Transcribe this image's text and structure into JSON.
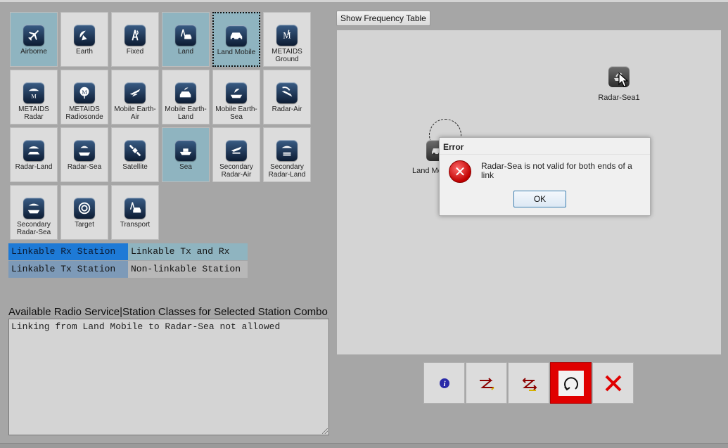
{
  "stations": [
    {
      "label": "Airborne",
      "icon": "airplane-icon",
      "state": "highlight"
    },
    {
      "label": "Earth",
      "icon": "dish-icon",
      "state": "normal"
    },
    {
      "label": "Fixed",
      "icon": "tower-icon",
      "state": "normal"
    },
    {
      "label": "Land",
      "icon": "tower-car-icon",
      "state": "highlight"
    },
    {
      "label": "Land Mobile",
      "icon": "car-icon",
      "state": "selected"
    },
    {
      "label": "METAIDS Ground",
      "icon": "metaids-ground-icon",
      "state": "normal"
    },
    {
      "label": "METAIDS Radar",
      "icon": "radar-icon",
      "state": "normal"
    },
    {
      "label": "METAIDS Radiosonde",
      "icon": "balloon-icon",
      "state": "normal"
    },
    {
      "label": "Mobile Earth-Air",
      "icon": "plane-dish-icon",
      "state": "normal"
    },
    {
      "label": "Mobile Earth-Land",
      "icon": "car-dish-icon",
      "state": "normal"
    },
    {
      "label": "Mobile Earth-Sea",
      "icon": "ship-dish-icon",
      "state": "normal"
    },
    {
      "label": "Radar-Air",
      "icon": "radar-plane-icon",
      "state": "normal"
    },
    {
      "label": "Radar-Land",
      "icon": "radar-land-icon",
      "state": "normal"
    },
    {
      "label": "Radar-Sea",
      "icon": "radar-sea-icon",
      "state": "normal"
    },
    {
      "label": "Satellite",
      "icon": "satellite-icon",
      "state": "normal"
    },
    {
      "label": "Sea",
      "icon": "ship-icon",
      "state": "highlight"
    },
    {
      "label": "Secondary Radar-Air",
      "icon": "secondary-radar-air-icon",
      "state": "normal"
    },
    {
      "label": "Secondary Radar-Land",
      "icon": "secondary-radar-land-icon",
      "state": "normal"
    },
    {
      "label": "Secondary Radar-Sea",
      "icon": "secondary-radar-sea-icon",
      "state": "normal"
    },
    {
      "label": "Target",
      "icon": "target-icon",
      "state": "normal"
    },
    {
      "label": "Transport",
      "icon": "transport-icon",
      "state": "normal"
    }
  ],
  "legend": {
    "rx": {
      "label": "Linkable Rx Station",
      "color": "#1e7ad6"
    },
    "txrx": {
      "label": "Linkable Tx and Rx",
      "color": "#8fb4c0"
    },
    "tx": {
      "label": "Linkable Tx Station",
      "color": "#7d9ab8"
    },
    "none": {
      "label": "Non-linkable Station",
      "color": "#b8b8b8"
    }
  },
  "available": {
    "title": "Available Radio Service|Station Classes for Selected Station Combo",
    "text": "Linking from Land Mobile to Radar-Sea not allowed"
  },
  "frequency_button": "Show Frequency Table",
  "canvas": {
    "nodes": [
      {
        "label": "Radar-Sea1",
        "icon": "radar-sea-icon"
      },
      {
        "label": "Land Mobile",
        "icon": "car-icon"
      }
    ]
  },
  "dialog": {
    "title": "Error",
    "message": "Radar-Sea is not valid for both ends of a link",
    "ok": "OK"
  },
  "toolbar": [
    {
      "name": "info-button",
      "icon": "info-icon"
    },
    {
      "name": "link-tx-button",
      "icon": "link-arrows-icon"
    },
    {
      "name": "swap-direction-button",
      "icon": "swap-arrows-icon"
    },
    {
      "name": "reset-button",
      "icon": "rotate-icon",
      "active": true
    },
    {
      "name": "delete-button",
      "icon": "close-icon"
    }
  ]
}
